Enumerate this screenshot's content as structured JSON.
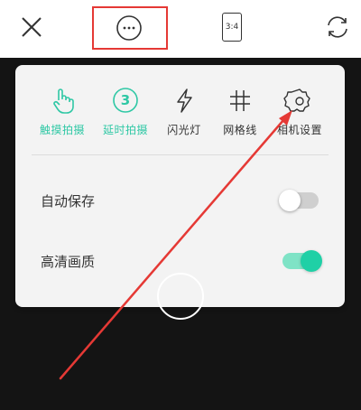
{
  "toolbar": {
    "close_icon": "close-icon",
    "more_icon": "more-horizontal-icon",
    "aspect_ratio": "3:4",
    "switch_camera_icon": "switch-camera-icon"
  },
  "options": [
    {
      "label": "触摸拍摄",
      "icon": "touch-icon",
      "active": true
    },
    {
      "label": "延时拍摄",
      "icon": "timer-icon",
      "badge": "3",
      "active": true
    },
    {
      "label": "闪光灯",
      "icon": "flash-icon",
      "active": false
    },
    {
      "label": "网格线",
      "icon": "grid-icon",
      "active": false
    },
    {
      "label": "相机设置",
      "icon": "settings-gear-icon",
      "active": false
    }
  ],
  "settings": [
    {
      "label": "自动保存",
      "enabled": false
    },
    {
      "label": "高清画质",
      "enabled": true
    }
  ],
  "colors": {
    "accent": "#2fc8a5",
    "annotation": "#e53935"
  }
}
